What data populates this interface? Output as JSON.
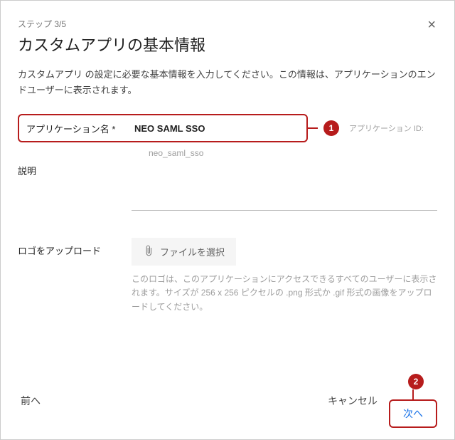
{
  "step": "ステップ 3/5",
  "title": "カスタムアプリの基本情報",
  "intro": "カスタムアプリ の設定に必要な基本情報を入力してください。この情報は、アプリケーションのエンドユーザーに表示されます。",
  "close_glyph": "×",
  "appName": {
    "label": "アプリケーション名 *",
    "value": "NEO SAML SSO"
  },
  "appId": {
    "label": "アプリケーション ID:",
    "value": "neo_saml_sso"
  },
  "description": {
    "label": "説明",
    "value": ""
  },
  "logo": {
    "label": "ロゴをアップロード",
    "button": "ファイルを選択",
    "help": "このロゴは、このアプリケーションにアクセスできるすべてのユーザーに表示されます。サイズが 256 x 256 ピクセルの .png 形式か .gif 形式の画像をアップロードしてください。"
  },
  "footer": {
    "back": "前へ",
    "cancel": "キャンセル",
    "next": "次へ"
  },
  "annotations": {
    "a1": "1",
    "a2": "2"
  }
}
